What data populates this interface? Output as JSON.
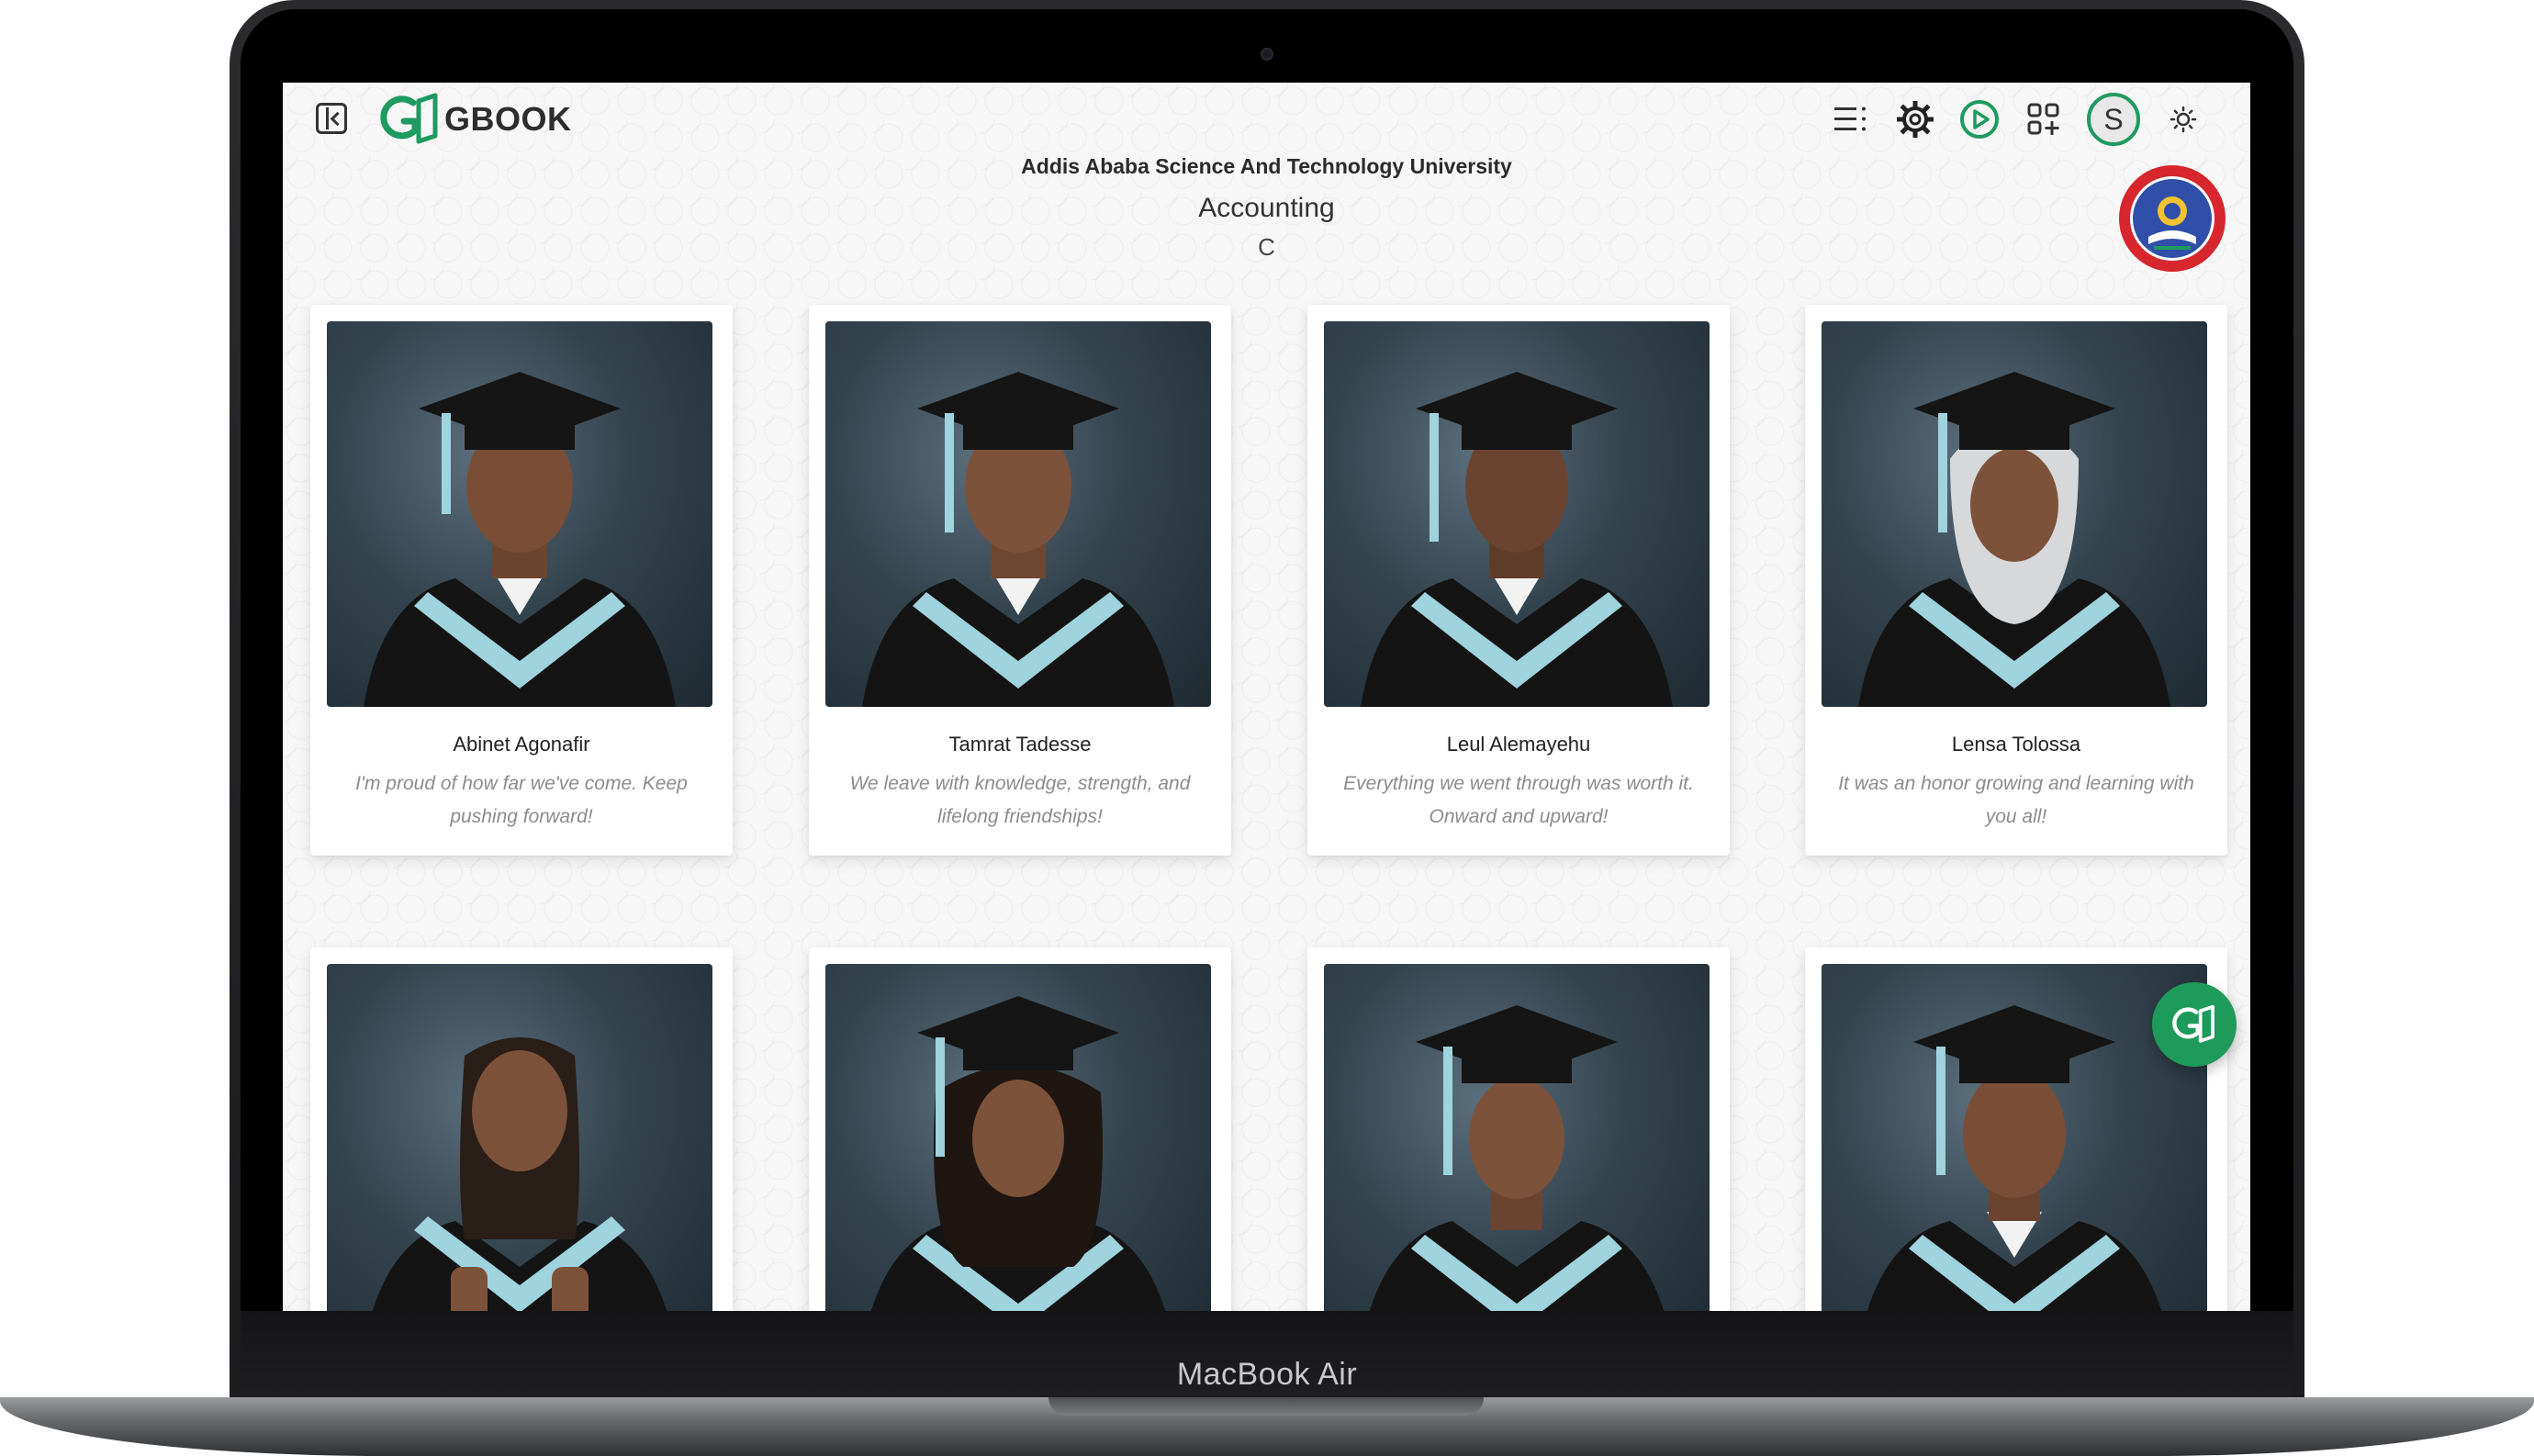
{
  "device": {
    "label": "MacBook Air"
  },
  "app": {
    "logo_text": "GBOOK",
    "accent_color": "#1f9a60",
    "user_initial": "S"
  },
  "toolbar": {
    "icons": [
      "menu-icon",
      "settings-icon",
      "play-icon",
      "apps-icon",
      "avatar",
      "theme-sun-icon"
    ]
  },
  "header": {
    "university": "Addis Ababa Science And Technology University",
    "department": "Accounting",
    "section": "C"
  },
  "students": [
    {
      "name": "Abinet Agonafir",
      "quote": "I'm proud of how far we've come. Keep pushing forward!"
    },
    {
      "name": "Tamrat Tadesse",
      "quote": "We leave with knowledge, strength, and lifelong friendships!"
    },
    {
      "name": "Leul Alemayehu",
      "quote": "Everything we went through was worth it. Onward and upward!"
    },
    {
      "name": "Lensa Tolossa",
      "quote": "It was an honor growing and learning with you all!"
    },
    {
      "name": "",
      "quote": ""
    },
    {
      "name": "",
      "quote": ""
    },
    {
      "name": "",
      "quote": ""
    },
    {
      "name": "",
      "quote": ""
    }
  ]
}
